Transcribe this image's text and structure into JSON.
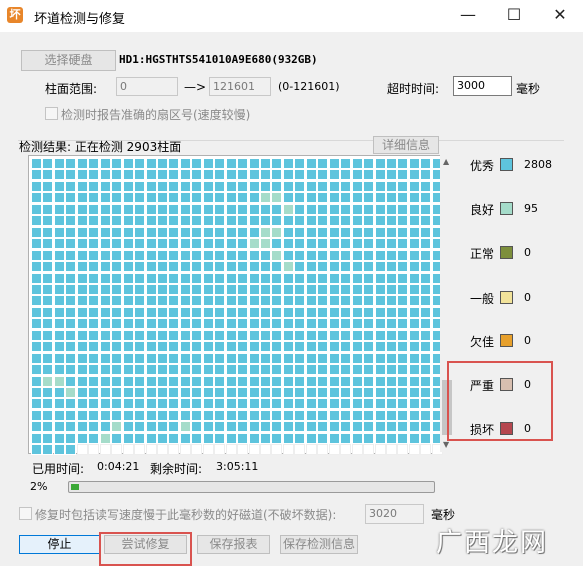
{
  "window": {
    "title": "坏道检测与修复",
    "icon": "坏"
  },
  "controls": {
    "select_disk": "选择硬盘",
    "disk_info": "HD1:HGSTHTS541010A9E680(932GB)",
    "cylinder_range_label": "柱面范围:",
    "range_start": "0",
    "range_arrow": "—>",
    "range_end": "121601",
    "range_hint": "(0-121601)",
    "timeout_label": "超时时间:",
    "timeout_value": "3000",
    "timeout_unit": "毫秒",
    "report_sector_label": "检测时报告准确的扇区号(速度较慢)"
  },
  "result": {
    "header": "检测结果: 正在检测 2903柱面",
    "details_button": "详细信息",
    "elapsed_label": "已用时间:",
    "elapsed_value": "0:04:21",
    "remaining_label": "剩余时间:",
    "remaining_value": "3:05:11",
    "progress_text": "2%",
    "progress": 0.02
  },
  "legend": [
    {
      "label": "优秀",
      "count": "2808",
      "color": "#5ec4dd"
    },
    {
      "label": "良好",
      "count": "95",
      "color": "#a5dcca"
    },
    {
      "label": "正常",
      "count": "0",
      "color": "#7d8f3c"
    },
    {
      "label": "一般",
      "count": "0",
      "color": "#f2e39a"
    },
    {
      "label": "欠佳",
      "count": "0",
      "color": "#e7a02c"
    },
    {
      "label": "严重",
      "count": "0",
      "color": "#d8bfb0"
    },
    {
      "label": "损坏",
      "count": "0",
      "color": "#b5474f"
    }
  ],
  "repair_option": {
    "label": "修复时包括读写速度慢于此毫秒数的好磁道(不破坏数据):",
    "value": "3020",
    "unit": "毫秒"
  },
  "buttons": {
    "stop": "停止",
    "try_repair": "尝试修复",
    "save_report": "保存报表",
    "save_info": "保存检测信息"
  },
  "grid": {
    "columns": 36,
    "rows_full": 25,
    "last_row_cells": 4,
    "cells_done": 2903
  },
  "watermark": "广西龙网"
}
